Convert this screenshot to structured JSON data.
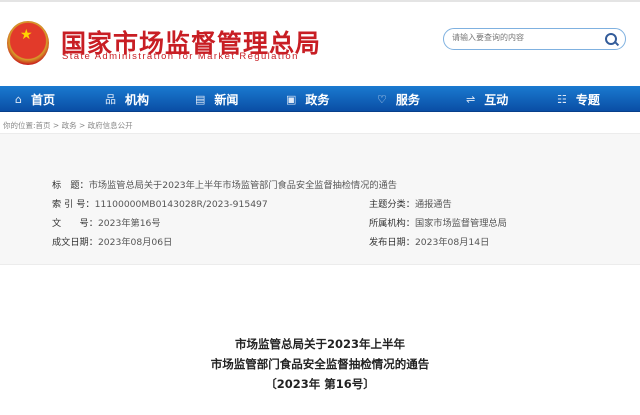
{
  "header": {
    "title_cn": "国家市场监督管理总局",
    "title_en": "State Administration for Market Regulation",
    "search_placeholder": "请输入要查询的内容"
  },
  "nav": [
    {
      "label": "首页",
      "icon": "home-icon",
      "glyph": "⌂"
    },
    {
      "label": "机构",
      "icon": "org-icon",
      "glyph": "品"
    },
    {
      "label": "新闻",
      "icon": "news-icon",
      "glyph": "▤"
    },
    {
      "label": "政务",
      "icon": "gov-icon",
      "glyph": "▣"
    },
    {
      "label": "服务",
      "icon": "heart-icon",
      "glyph": "♡"
    },
    {
      "label": "互动",
      "icon": "exchange-icon",
      "glyph": "⇌"
    },
    {
      "label": "专题",
      "icon": "list-icon",
      "glyph": "☷"
    }
  ],
  "breadcrumb": "你的位置:首页 > 政务 > 政府信息公开",
  "meta": {
    "title_label": "标　题：",
    "title_value": "市场监管总局关于2023年上半年市场监管部门食品安全监督抽检情况的通告",
    "index_label": "索 引 号：",
    "index_value": "11100000MB0143028R/2023-915497",
    "category_label": "主题分类：",
    "category_value": "通报通告",
    "docno_label": "文　　号：",
    "docno_value": "2023年第16号",
    "org_label": "所属机构：",
    "org_value": "国家市场监督管理总局",
    "date_label": "成文日期：",
    "date_value": "2023年08月06日",
    "pub_label": "发布日期：",
    "pub_value": "2023年08月14日"
  },
  "document": {
    "line1": "市场监管总局关于2023年上半年",
    "line2": "市场监管部门食品安全监督抽检情况的通告",
    "line3": "〔2023年 第16号〕"
  }
}
